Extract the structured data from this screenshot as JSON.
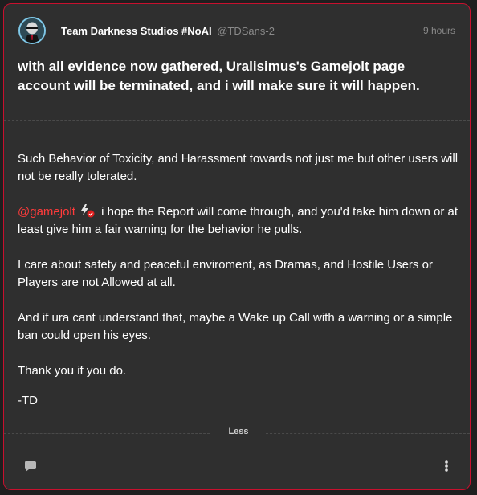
{
  "post": {
    "author_name": "Team Darkness Studios #NoAI",
    "author_handle": "@TDSans-2",
    "time": "9 hours",
    "lead": "with all evidence now gathered, Uralisimus's Gamejolt page account will be terminated, and i will make sure it will happen.",
    "paragraphs": [
      "Such Behavior of Toxicity, and Harassment towards not just me but other users will not be really tolerated.",
      "I care about safety and peaceful enviroment, as Dramas, and Hostile Users or Players are not Allowed at all.",
      "And if ura cant understand that, maybe a Wake up Call with a warning or a simple ban could open his eyes.",
      "Thank you if you do.",
      "-TD"
    ],
    "mention": "@gamejolt",
    "mention_text": " i hope the Report will come through, and you'd take him down or at least give him a fair warning for the behavior he pulls.",
    "less_label": "Less",
    "icons": {
      "comment": "comment-icon",
      "more": "more-vertical-icon",
      "badge": "lightning-badge-icon"
    }
  },
  "colors": {
    "card_bg": "#2f2f2f",
    "border": "#c8102e",
    "mention": "#ff3b3b",
    "muted": "#8a8a8a"
  }
}
